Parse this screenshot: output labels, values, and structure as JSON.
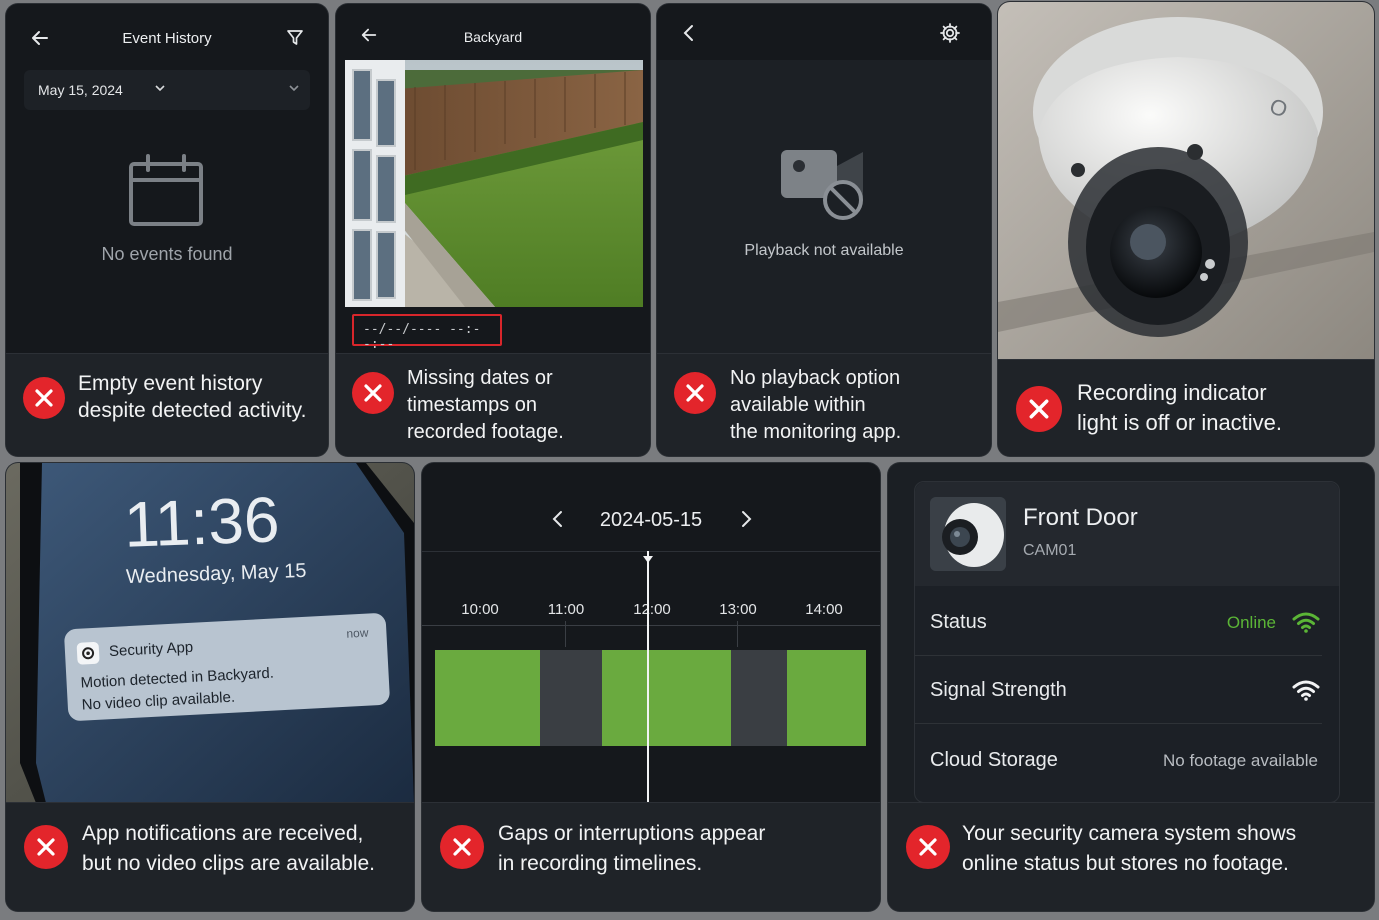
{
  "panel_event_history": {
    "title": "Event History",
    "date": "May 15, 2024",
    "empty_text": "No events found",
    "caption_line1": "Empty event history",
    "caption_line2": "despite detected activity."
  },
  "panel_backyard": {
    "title": "Backyard",
    "timestamp": "--/--/---- --:--:--",
    "caption_line1": "Missing dates or",
    "caption_line2": "timestamps on",
    "caption_line3": "recorded footage."
  },
  "panel_playback": {
    "message": "Playback not available",
    "caption_line1": "No playback option",
    "caption_line2": "available within",
    "caption_line3": "the monitoring app."
  },
  "panel_camera": {
    "caption_line1": "Recording indicator",
    "caption_line2": "light is off or inactive."
  },
  "panel_notification": {
    "time": "11:36",
    "date": "Wednesday, May 15",
    "app_name": "Security App",
    "age": "now",
    "message_line1": "Motion detected in Backyard.",
    "message_line2": "No video clip available.",
    "caption_line1": "App notifications are received,",
    "caption_line2": "but no video clips are available."
  },
  "panel_timeline": {
    "date": "2024-05-15",
    "ticks": [
      "10:00",
      "11:00",
      "12:00",
      "13:00",
      "14:00"
    ],
    "caption_line1": "Gaps or interruptions appear",
    "caption_line2": "in recording timelines."
  },
  "panel_device": {
    "name": "Front Door",
    "id": "CAM01",
    "rows": [
      {
        "label": "Status",
        "value": "Online"
      },
      {
        "label": "Signal Strength",
        "value": ""
      },
      {
        "label": "Cloud Storage",
        "value": "No footage available"
      }
    ],
    "caption_line1": "Your security camera system shows",
    "caption_line2": "online status but stores no footage."
  },
  "colors": {
    "error_red": "#e3252b",
    "recording_green": "#6aaa3f",
    "gap_gray": "#3a3e43",
    "online_green": "#5bb536"
  }
}
